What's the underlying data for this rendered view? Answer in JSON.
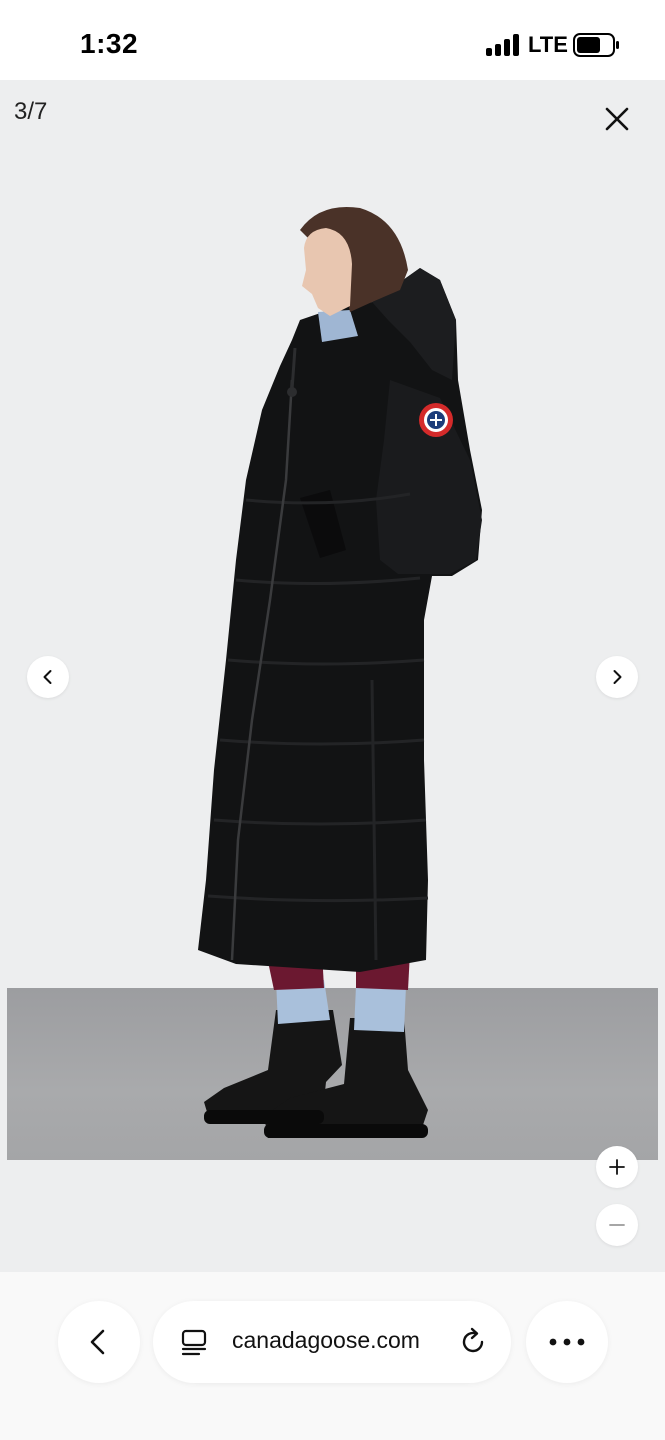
{
  "status_bar": {
    "time": "1:32",
    "network": "LTE",
    "icons": [
      "signal-icon",
      "battery-icon"
    ]
  },
  "gallery": {
    "counter": "3/7",
    "current_index": 3,
    "total_images": 7,
    "image_alt": "product-photo-black-long-down-parka",
    "icons": [
      "close-icon",
      "chevron-left-icon",
      "chevron-right-icon",
      "plus-icon",
      "minus-icon"
    ],
    "colors": {
      "background": "#edeeef",
      "coat": "#121314",
      "badge_red": "#d42a2a"
    }
  },
  "browser": {
    "url": "canadagoose.com",
    "icons": [
      "back-chevron-icon",
      "tabs-icon",
      "reload-icon",
      "more-icon"
    ]
  }
}
